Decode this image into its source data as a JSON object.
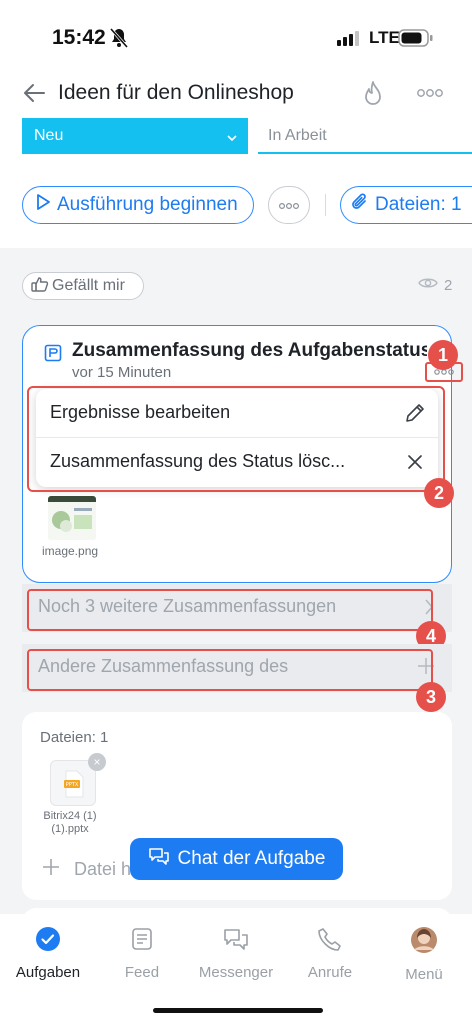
{
  "status_bar": {
    "time": "15:42",
    "network": "LTE"
  },
  "header": {
    "title": "Ideen für den Onlineshop"
  },
  "stages": {
    "current": "Neu",
    "next": "In Arbeit"
  },
  "actions": {
    "start_label": "Ausführung beginnen",
    "files_label": "Dateien: 1"
  },
  "reactions": {
    "like_label": "Gefällt mir",
    "views": "2"
  },
  "summary": {
    "title": "Zusammenfassung des Aufgabenstatus",
    "time": "vor 15 Minuten",
    "attachment_name": "image.png"
  },
  "context_menu": {
    "items": [
      {
        "label": "Ergebnisse bearbeiten",
        "icon": "pencil-icon"
      },
      {
        "label": "Zusammenfassung des Status lösc...",
        "icon": "close-icon"
      }
    ]
  },
  "more_summaries": {
    "label": "Noch 3 weitere Zusammenfassungen"
  },
  "other_summary": {
    "label": "Andere Zusammenfassung des"
  },
  "files": {
    "title": "Dateien: 1",
    "items": [
      {
        "name": "Bitrix24 (1) (1).pptx",
        "ext": "PPTX"
      }
    ],
    "add_label": "Datei h"
  },
  "chat_button": {
    "label": "Chat der Aufgabe"
  },
  "annotations": {
    "badges": [
      "1",
      "2",
      "3",
      "4"
    ],
    "color": "#e5504b"
  },
  "tabbar": {
    "items": [
      {
        "label": "Aufgaben",
        "icon": "check-circle-icon",
        "active": true
      },
      {
        "label": "Feed",
        "icon": "feed-icon",
        "active": false
      },
      {
        "label": "Messenger",
        "icon": "messenger-icon",
        "active": false
      },
      {
        "label": "Anrufe",
        "icon": "phone-icon",
        "active": false
      },
      {
        "label": "Menü",
        "icon": "avatar-icon",
        "active": false
      }
    ]
  },
  "colors": {
    "accent": "#1d7cf2",
    "stage": "#13c0f0",
    "highlight": "#e5504b"
  }
}
